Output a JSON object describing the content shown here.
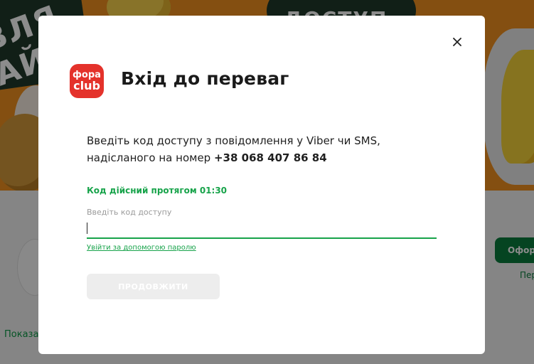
{
  "background": {
    "banner_left_text": "ВЛЯ АЙН",
    "banner_center_text": "ДОСТУП",
    "show_link": "Показат",
    "right_button": "Оформ",
    "right_link": "Пер"
  },
  "modal": {
    "logo": {
      "line1": "фора",
      "line2": "club"
    },
    "title": "Вхід до переваг",
    "description_line1": "Введіть код доступу з повідомлення у Viber чи SMS,",
    "description_line2_prefix": "надісланого на номер ",
    "phone": "+38 068 407 86 84",
    "validity": "Код дійсний протягом 01:30",
    "field_label": "Введіть код доступу",
    "input_value": "",
    "password_link": "Увійти за допомогою паролю",
    "continue_label": "ПРОДОВЖИТИ"
  },
  "colors": {
    "brand_red": "#e4322b",
    "accent_green": "#17a34a",
    "banner_orange": "#f0901f"
  }
}
